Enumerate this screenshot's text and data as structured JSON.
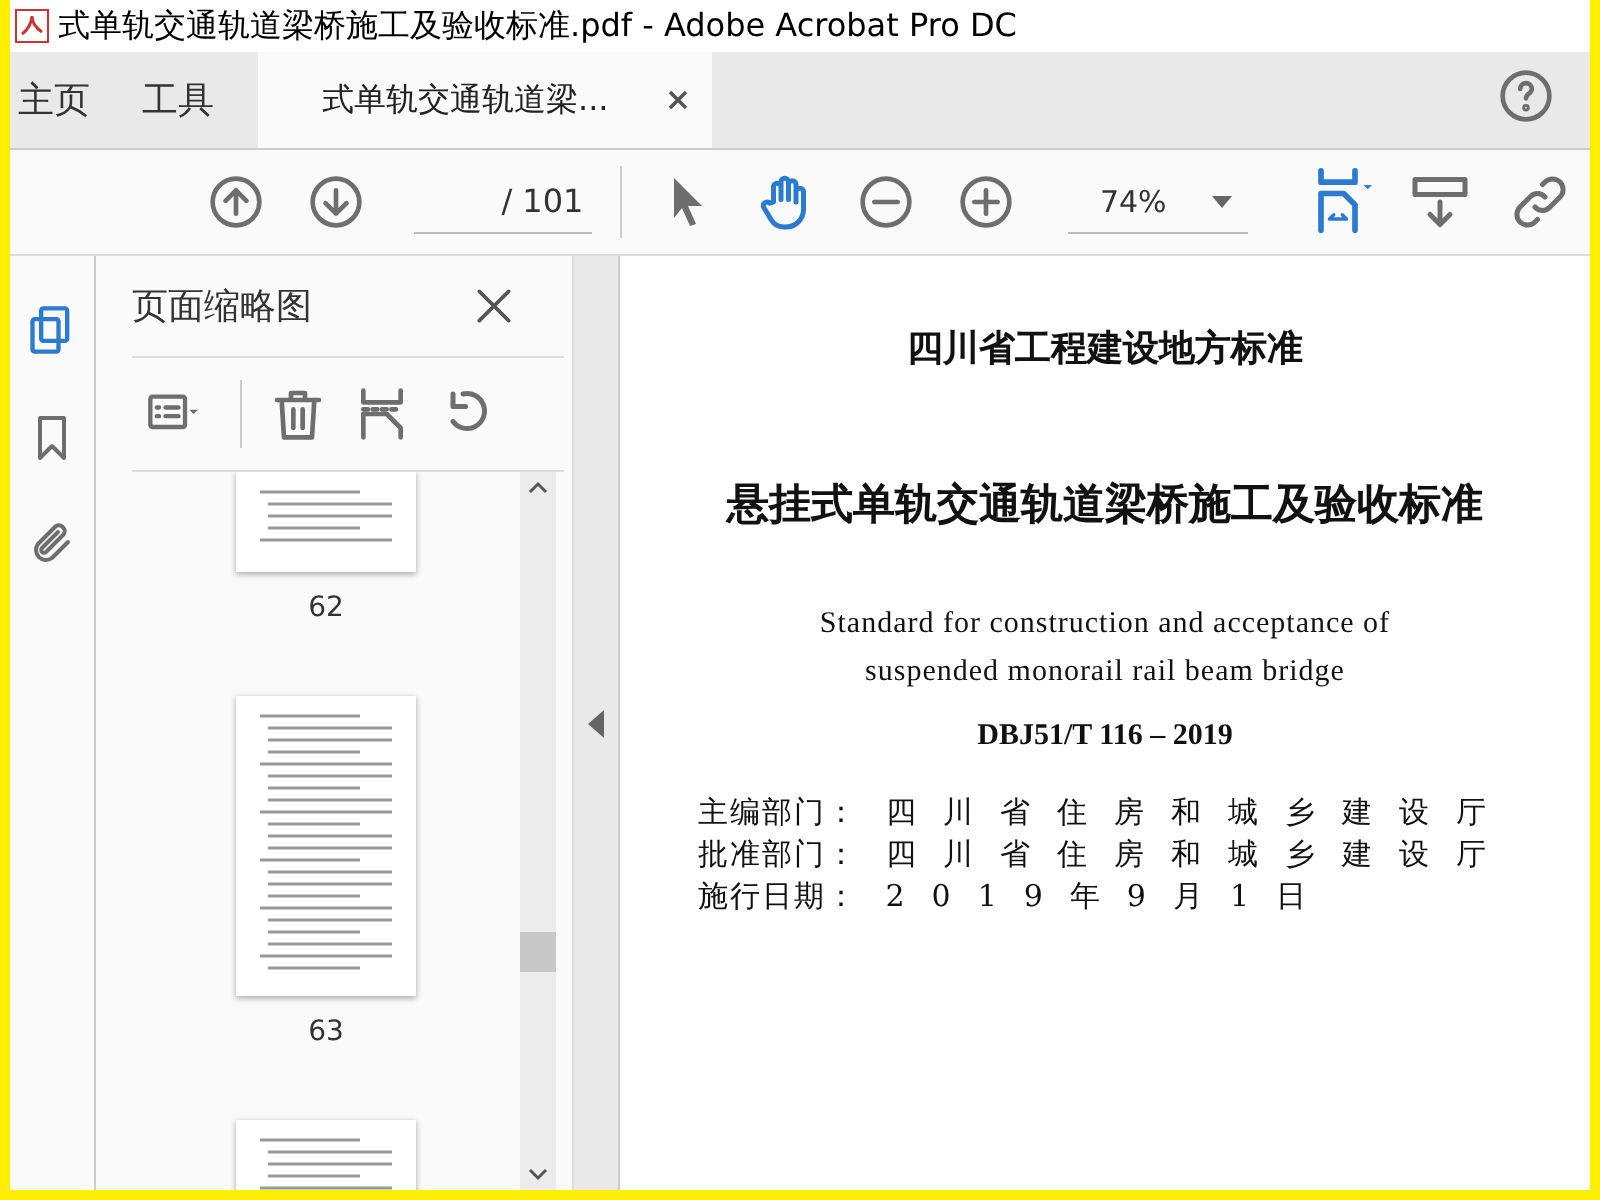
{
  "window": {
    "title": "式单轨交通轨道梁桥施工及验收标准.pdf - Adobe Acrobat Pro DC"
  },
  "tabs": [
    {
      "label": "主页",
      "selected": false,
      "kind": "nav"
    },
    {
      "label": "工具",
      "selected": false,
      "kind": "nav"
    },
    {
      "label": "式单轨交通轨道梁...",
      "selected": true,
      "kind": "doc"
    }
  ],
  "toolbar": {
    "page_total": "/ 101",
    "zoom": "74%"
  },
  "side_rail": [
    {
      "kind": "pages",
      "selected": true
    },
    {
      "kind": "bookmark",
      "selected": false
    },
    {
      "kind": "attachment",
      "selected": false
    }
  ],
  "thumbnails_panel": {
    "title": "页面缩略图",
    "pages": [
      {
        "label": "62"
      },
      {
        "label": "63"
      }
    ]
  },
  "document": {
    "header": "四川省工程建设地方标准",
    "title": "悬挂式单轨交通轨道梁桥施工及验收标准",
    "subtitle_lines": [
      "Standard for construction and acceptance of",
      "suspended monorail rail beam bridge"
    ],
    "code": "DBJ51/T 116 – 2019",
    "rows": [
      {
        "label": "主编部门：",
        "value": "四川省住房和城乡建设厅"
      },
      {
        "label": "批准部门：",
        "value": "四川省住房和城乡建设厅"
      },
      {
        "label": "施行日期：",
        "value": "2019年9月1日"
      }
    ]
  }
}
